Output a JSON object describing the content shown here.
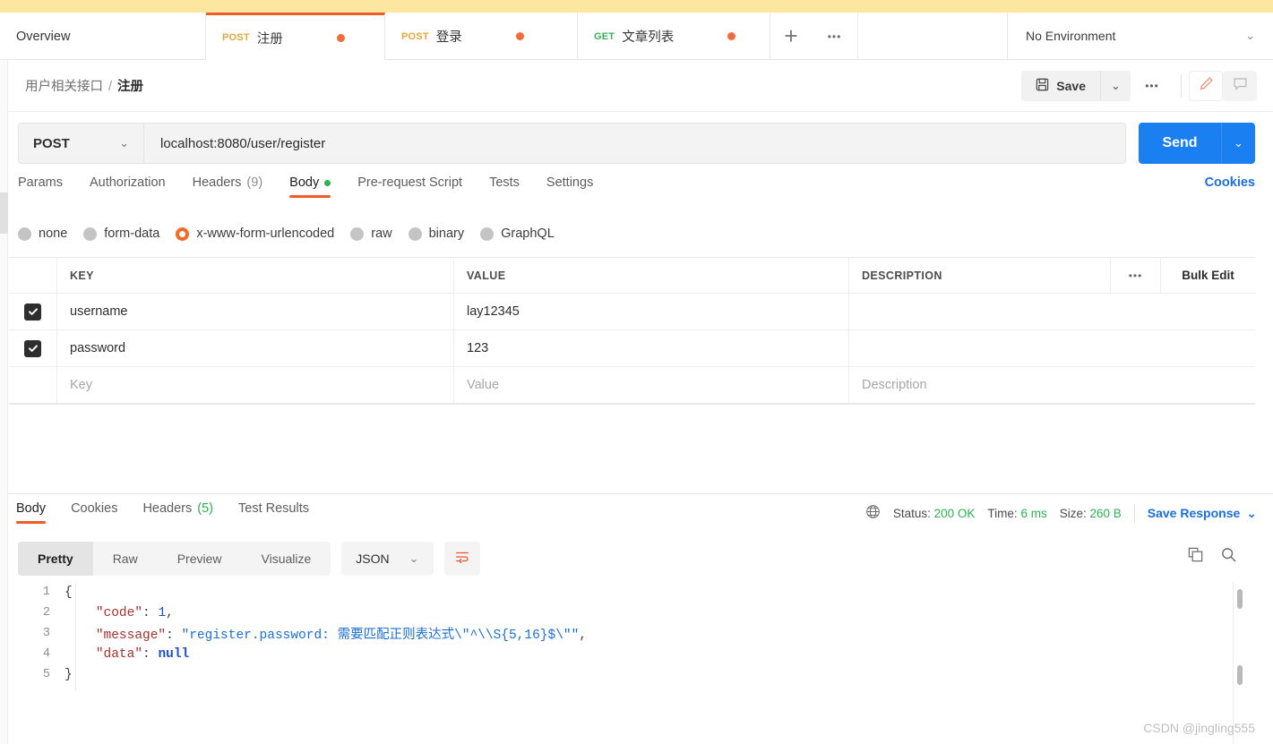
{
  "tabbar": {
    "overview_label": "Overview",
    "tabs": [
      {
        "verb": "POST",
        "name": "注册"
      },
      {
        "verb": "POST",
        "name": "登录"
      },
      {
        "verb": "GET",
        "name": "文章列表"
      }
    ],
    "plus_label": "+",
    "dots_label": "•••",
    "environment": "No Environment",
    "env_chevron": "⌄"
  },
  "header": {
    "breadcrumb_parent": "用户相关接口",
    "breadcrumb_sep": "/",
    "breadcrumb_current": "注册",
    "save_label": "Save",
    "save_caret": "⌄",
    "more_dots": "•••"
  },
  "request": {
    "method": "POST",
    "method_chevron": "⌄",
    "url": "localhost:8080/user/register",
    "send_label": "Send",
    "send_caret": "⌄",
    "tabs": [
      {
        "label": "Params",
        "count": ""
      },
      {
        "label": "Authorization",
        "count": ""
      },
      {
        "label": "Headers",
        "count": "(9)"
      },
      {
        "label": "Body",
        "count": ""
      },
      {
        "label": "Pre-request Script",
        "count": ""
      },
      {
        "label": "Tests",
        "count": ""
      },
      {
        "label": "Settings",
        "count": ""
      }
    ],
    "cookies_label": "Cookies",
    "body_types": [
      {
        "label": "none",
        "selected": false
      },
      {
        "label": "form-data",
        "selected": false
      },
      {
        "label": "x-www-form-urlencoded",
        "selected": true
      },
      {
        "label": "raw",
        "selected": false
      },
      {
        "label": "binary",
        "selected": false
      },
      {
        "label": "GraphQL",
        "selected": false
      }
    ]
  },
  "table": {
    "headers": {
      "key": "KEY",
      "value": "VALUE",
      "description": "DESCRIPTION"
    },
    "dots": "•••",
    "bulk_edit": "Bulk Edit",
    "rows": [
      {
        "checked": true,
        "key": "username",
        "value": "lay12345",
        "description": ""
      },
      {
        "checked": true,
        "key": "password",
        "value": "123",
        "description": ""
      }
    ],
    "placeholders": {
      "key": "Key",
      "value": "Value",
      "description": "Description"
    }
  },
  "response": {
    "tabs": [
      {
        "label": "Body",
        "count": ""
      },
      {
        "label": "Cookies",
        "count": ""
      },
      {
        "label": "Headers",
        "count": "(5)"
      },
      {
        "label": "Test Results",
        "count": ""
      }
    ],
    "status_label": "Status:",
    "status_value": "200 OK",
    "time_label": "Time:",
    "time_value": "6 ms",
    "size_label": "Size:",
    "size_value": "260 B",
    "save_response": "Save Response",
    "save_response_caret": "⌄",
    "view_modes": [
      {
        "label": "Pretty",
        "active": true
      },
      {
        "label": "Raw",
        "active": false
      },
      {
        "label": "Preview",
        "active": false
      },
      {
        "label": "Visualize",
        "active": false
      }
    ],
    "format": "JSON",
    "format_chevron": "⌄",
    "code": {
      "lines": [
        {
          "n": "1",
          "parts": [
            {
              "t": "brace",
              "s": "{"
            }
          ]
        },
        {
          "n": "2",
          "parts": [
            {
              "t": "p",
              "s": "    "
            },
            {
              "t": "key",
              "s": "\"code\""
            },
            {
              "t": "p",
              "s": ": "
            },
            {
              "t": "num",
              "s": "1"
            },
            {
              "t": "p",
              "s": ","
            }
          ]
        },
        {
          "n": "3",
          "parts": [
            {
              "t": "p",
              "s": "    "
            },
            {
              "t": "key",
              "s": "\"message\""
            },
            {
              "t": "p",
              "s": ": "
            },
            {
              "t": "str",
              "s": "\"register.password: 需要匹配正则表达式\\\"^\\\\S{5,16}$\\\"\""
            },
            {
              "t": "p",
              "s": ","
            }
          ]
        },
        {
          "n": "4",
          "parts": [
            {
              "t": "p",
              "s": "    "
            },
            {
              "t": "key",
              "s": "\"data\""
            },
            {
              "t": "p",
              "s": ": "
            },
            {
              "t": "null",
              "s": "null"
            }
          ]
        },
        {
          "n": "5",
          "parts": [
            {
              "t": "brace",
              "s": "}"
            }
          ]
        }
      ]
    }
  },
  "watermark": "CSDN @jingling555",
  "colors": {
    "accent_orange": "#ef5b25",
    "send_blue": "#1a7ff0",
    "link_blue": "#1a6fe0",
    "green": "#2bb24c",
    "banner_yellow": "#fce6a0"
  }
}
